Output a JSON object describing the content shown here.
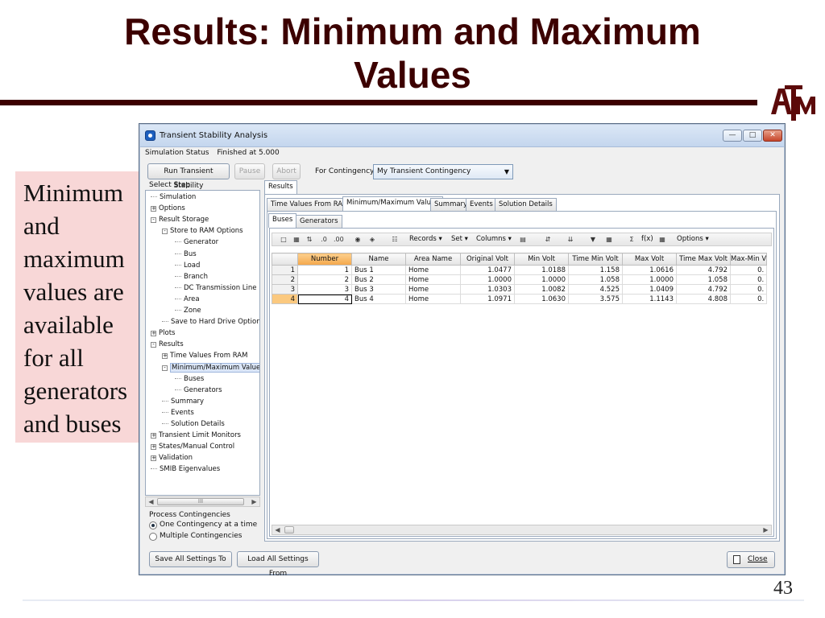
{
  "slide": {
    "title_line1": "Results: Minimum and Maximum",
    "title_line2": "Values",
    "page_number": "43",
    "logo_icon": "atm-logo",
    "sidenote_lines": [
      "Minimum",
      "and",
      "maximum",
      "values are",
      "available",
      "for all",
      "generators",
      "and buses"
    ]
  },
  "window": {
    "title": "Transient Stability Analysis",
    "status_label": "Simulation Status",
    "status_value": "Finished at 5.000",
    "buttons": {
      "run": "Run Transient Stability",
      "pause": "Pause",
      "abort": "Abort"
    },
    "contingency_label": "For Contingency:",
    "contingency_value": "My Transient Contingency",
    "select_step_label": "Select Step",
    "tree": [
      {
        "label": "Simulation",
        "level": 0,
        "toggle": ""
      },
      {
        "label": "Options",
        "level": 0,
        "toggle": "+"
      },
      {
        "label": "Result Storage",
        "level": 0,
        "toggle": "-"
      },
      {
        "label": "Store to RAM Options",
        "level": 1,
        "toggle": "-"
      },
      {
        "label": "Generator",
        "level": 2,
        "toggle": ""
      },
      {
        "label": "Bus",
        "level": 2,
        "toggle": ""
      },
      {
        "label": "Load",
        "level": 2,
        "toggle": ""
      },
      {
        "label": "Branch",
        "level": 2,
        "toggle": ""
      },
      {
        "label": "DC Transmission Line",
        "level": 2,
        "toggle": ""
      },
      {
        "label": "Area",
        "level": 2,
        "toggle": ""
      },
      {
        "label": "Zone",
        "level": 2,
        "toggle": ""
      },
      {
        "label": "Save to Hard Drive Options",
        "level": 1,
        "toggle": ""
      },
      {
        "label": "Plots",
        "level": 0,
        "toggle": "+"
      },
      {
        "label": "Results",
        "level": 0,
        "toggle": "-"
      },
      {
        "label": "Time Values From RAM",
        "level": 1,
        "toggle": "+"
      },
      {
        "label": "Minimum/Maximum Values",
        "level": 1,
        "toggle": "-",
        "selected": true
      },
      {
        "label": "Buses",
        "level": 2,
        "toggle": ""
      },
      {
        "label": "Generators",
        "level": 2,
        "toggle": ""
      },
      {
        "label": "Summary",
        "level": 1,
        "toggle": ""
      },
      {
        "label": "Events",
        "level": 1,
        "toggle": ""
      },
      {
        "label": "Solution Details",
        "level": 1,
        "toggle": ""
      },
      {
        "label": "Transient Limit Monitors",
        "level": 0,
        "toggle": "+"
      },
      {
        "label": "States/Manual Control",
        "level": 0,
        "toggle": "+"
      },
      {
        "label": "Validation",
        "level": 0,
        "toggle": "+"
      },
      {
        "label": "SMIB Eigenvalues",
        "level": 0,
        "toggle": ""
      }
    ],
    "process_label": "Process Contingencies",
    "process_options": [
      "One Contingency at a time",
      "Multiple Contingencies"
    ],
    "process_selected": "One Contingency at a time",
    "results_tab": "Results",
    "result_tabs": [
      "Time Values From RAM",
      "Minimum/Maximum Values",
      "Summary",
      "Events",
      "Solution Details"
    ],
    "active_result_tab": "Minimum/Maximum Values",
    "sub_tabs": [
      "Buses",
      "Generators"
    ],
    "active_sub_tab": "Buses",
    "toolbar": {
      "records": "Records ▾",
      "set": "Set ▾",
      "columns": "Columns ▾",
      "fx": "f(x)",
      "options": "Options ▾"
    },
    "grid": {
      "headers": [
        "Number",
        "Name",
        "Area Name",
        "Original Volt",
        "Min Volt",
        "Time Min Volt",
        "Max Volt",
        "Time Max Volt",
        "Max-Min V"
      ],
      "rows": [
        {
          "row": "1",
          "cells": [
            "1",
            "Bus 1",
            "Home",
            "1.0477",
            "1.0188",
            "1.158",
            "1.0616",
            "4.792",
            "0."
          ]
        },
        {
          "row": "2",
          "cells": [
            "2",
            "Bus 2",
            "Home",
            "1.0000",
            "1.0000",
            "1.058",
            "1.0000",
            "1.058",
            "0."
          ]
        },
        {
          "row": "3",
          "cells": [
            "3",
            "Bus 3",
            "Home",
            "1.0303",
            "1.0082",
            "4.525",
            "1.0409",
            "4.792",
            "0."
          ]
        },
        {
          "row": "4",
          "cells": [
            "4",
            "Bus 4",
            "Home",
            "1.0971",
            "1.0630",
            "3.575",
            "1.1143",
            "4.808",
            "0."
          ]
        }
      ]
    },
    "footer": {
      "save_to": "Save All Settings To",
      "load_from": "Load All Settings From",
      "close": "Close"
    }
  }
}
